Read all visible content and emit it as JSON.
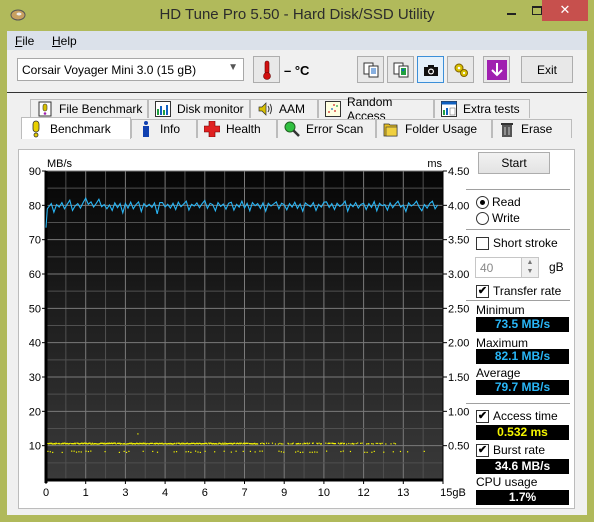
{
  "window": {
    "title": "HD Tune Pro 5.50 - Hard Disk/SSD Utility",
    "close_label": "✕"
  },
  "menu": [
    {
      "label": "File",
      "accel": "F"
    },
    {
      "label": "Help",
      "accel": "H"
    }
  ],
  "toolbar": {
    "drive": "Corsair Voyager Mini 3.0 (15 gB)",
    "temperature": "– °C",
    "exit_label": "Exit",
    "icons": [
      "copy-text-icon",
      "copy-screenshot-icon",
      "camera-icon",
      "options-icon",
      "save-icon"
    ]
  },
  "tabs_top": [
    {
      "label": "File Benchmark",
      "icon": "file-benchmark-icon"
    },
    {
      "label": "Disk monitor",
      "icon": "disk-monitor-icon"
    },
    {
      "label": "AAM",
      "icon": "speaker-icon"
    },
    {
      "label": "Random Access",
      "icon": "random-access-icon"
    },
    {
      "label": "Extra tests",
      "icon": "extra-tests-icon"
    }
  ],
  "tabs_bottom": [
    {
      "label": "Benchmark",
      "icon": "benchmark-icon",
      "active": true
    },
    {
      "label": "Info",
      "icon": "info-icon"
    },
    {
      "label": "Health",
      "icon": "health-icon"
    },
    {
      "label": "Error Scan",
      "icon": "magnifier-icon"
    },
    {
      "label": "Folder Usage",
      "icon": "folder-icon"
    },
    {
      "label": "Erase",
      "icon": "trash-icon"
    }
  ],
  "side": {
    "start_label": "Start",
    "read_label": "Read",
    "write_label": "Write",
    "mode": "read",
    "short_stroke_label": "Short stroke",
    "short_stroke_checked": false,
    "short_stroke_value": "40",
    "short_stroke_unit": "gB",
    "transfer_rate_label": "Transfer rate",
    "transfer_rate_checked": true,
    "minimum_label": "Minimum",
    "minimum_value": "73.5 MB/s",
    "maximum_label": "Maximum",
    "maximum_value": "82.1 MB/s",
    "average_label": "Average",
    "average_value": "79.7 MB/s",
    "access_time_label": "Access time",
    "access_time_checked": true,
    "access_time_value": "0.532 ms",
    "burst_rate_label": "Burst rate",
    "burst_rate_checked": true,
    "burst_rate_value": "34.6 MB/s",
    "cpu_usage_label": "CPU usage",
    "cpu_usage_value": "1.7%"
  },
  "colors": {
    "transfer": "#29b6f6",
    "access": "#f5f500",
    "burst": "#ffffff",
    "cpu": "#ffffff"
  },
  "chart_data": {
    "type": "line",
    "title": "",
    "ylabel": "MB/s",
    "y2label": "ms",
    "ylim": [
      0,
      90
    ],
    "y2lim": [
      0,
      4.5
    ],
    "xlim": [
      0,
      15
    ],
    "yticks": [
      "90",
      "80",
      "70",
      "60",
      "50",
      "40",
      "30",
      "20",
      "10"
    ],
    "y2ticks": [
      "4.50",
      "4.00",
      "3.50",
      "3.00",
      "2.50",
      "2.00",
      "1.50",
      "1.00",
      "0.50"
    ],
    "xticks": [
      "0",
      "1",
      "3",
      "4",
      "6",
      "7",
      "9",
      "10",
      "12",
      "13",
      "15gB"
    ],
    "grid": true,
    "series": [
      {
        "name": "Transfer rate",
        "axis": "left",
        "x": [
          0,
          0.05,
          0.1,
          0.2,
          0.3,
          0.4,
          0.5,
          0.6,
          0.7,
          0.8,
          0.9,
          1.0,
          1.1,
          1.2,
          1.3,
          1.4,
          1.5,
          1.6,
          1.7,
          1.8,
          1.9,
          2.0,
          2.1,
          2.2,
          2.3,
          2.4,
          2.5,
          2.6,
          2.7,
          2.8,
          2.9,
          3.0,
          3.1,
          3.2,
          3.3,
          3.4,
          3.5,
          3.6,
          3.7,
          3.8,
          3.9,
          4.0,
          4.1,
          4.2,
          4.3,
          4.4,
          4.5,
          4.6,
          4.7,
          4.8,
          4.9,
          5.0,
          5.1,
          5.2,
          5.3,
          5.4,
          5.5,
          5.6,
          5.7,
          5.8,
          5.9,
          6.0,
          6.1,
          6.2,
          6.3,
          6.4,
          6.5,
          6.6,
          6.7,
          6.8,
          6.9,
          7.0,
          7.1,
          7.2,
          7.3,
          7.4,
          7.5,
          7.6,
          7.7,
          7.8,
          7.9,
          8.0,
          8.1,
          8.2,
          8.3,
          8.4,
          8.5,
          8.6,
          8.7,
          8.8,
          8.9,
          9.0,
          9.1,
          9.2,
          9.3,
          9.4,
          9.5,
          9.6,
          9.7,
          9.8,
          9.9,
          10.0,
          10.1,
          10.2,
          10.3,
          10.4,
          10.5,
          10.6,
          10.7,
          10.8,
          10.9,
          11.0,
          11.1,
          11.2,
          11.3,
          11.4,
          11.5,
          11.6,
          11.7,
          11.8,
          11.9,
          12.0,
          12.1,
          12.2,
          12.3,
          12.4,
          12.5,
          12.6,
          12.7,
          12.8,
          12.9,
          13.0,
          13.1,
          13.2,
          13.3,
          13.4,
          13.5,
          13.6,
          13.7,
          13.8,
          13.9,
          14.0,
          14.1,
          14.2,
          14.3,
          14.4,
          14.5,
          14.6,
          14.7,
          14.8,
          14.9,
          15.0
        ],
        "values": [
          73.5,
          79,
          79.5,
          80.5,
          78,
          80.2,
          79.5,
          80.8,
          79,
          80.3,
          81.5,
          78.5,
          79.8,
          80.5,
          79.2,
          80.8,
          82.1,
          80.3,
          81,
          79.5,
          80.6,
          81.8,
          79.6,
          80.2,
          79,
          80.1,
          78.5,
          80.7,
          79.3,
          80.5,
          77.8,
          80.6,
          79.2,
          80.9,
          79,
          80.2,
          81,
          78.2,
          80.5,
          79.6,
          80.3,
          79.4,
          80.7,
          77.5,
          80.8,
          80.8,
          79.5,
          80.3,
          79.2,
          80.6,
          78.8,
          80.9,
          79.6,
          80.4,
          81.2,
          78.6,
          80.3,
          79.8,
          80.7,
          79.3,
          80.5,
          81.4,
          79.1,
          80.6,
          80.2,
          78.4,
          80.8,
          79.7,
          80.4,
          78.9,
          80.6,
          80.9,
          78.6,
          80.3,
          79.5,
          81.2,
          79.2,
          80.6,
          78.4,
          80.8,
          79.9,
          80.5,
          79.1,
          80.7,
          78.3,
          80.6,
          79.8,
          80.4,
          81,
          79,
          80.6,
          80.2,
          78.7,
          80.5,
          79.5,
          80.9,
          79.1,
          80.4,
          78.3,
          80.7,
          80.1,
          79.6,
          80.8,
          78.5,
          80.3,
          79.5,
          80.9,
          81,
          79.4,
          80.5,
          78.8,
          80.6,
          79.7,
          80.2,
          81.2,
          78.3,
          80.4,
          79.6,
          80.8,
          79.2,
          80.3,
          80.6,
          78.8,
          80.5,
          79.4,
          81.1,
          78.4,
          80.6,
          79.9,
          80.2,
          78.6,
          80.7,
          79.3,
          80.4,
          81.2,
          79.5,
          80.1,
          78.2,
          80.7,
          79.8,
          80.3,
          81.2,
          79.5,
          78.4,
          80.2,
          79.2,
          80.6,
          81.2,
          79,
          80.1
        ]
      },
      {
        "name": "Access time",
        "axis": "right",
        "type": "scatter",
        "description": "dense band of points near 0.53 ms (10.6 on left scale) across 0–13 gB, sparse points near 0.42 ms",
        "band_ms": 0.532,
        "low_band_ms": 0.42,
        "outlier_ms": 0.68
      }
    ]
  }
}
